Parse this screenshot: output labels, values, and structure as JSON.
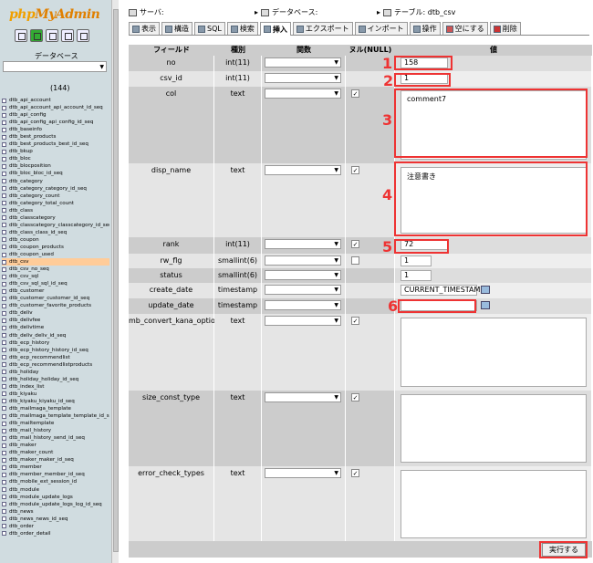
{
  "sidebar": {
    "logo_part1": "php",
    "logo_part2": "MyAdmin",
    "db_label": "データベース",
    "db_select_value": "",
    "db_count": "(144)",
    "tables": [
      "dtb_api_account",
      "dtb_api_account_api_account_id_seq",
      "dtb_api_config",
      "dtb_api_config_api_config_id_seq",
      "dtb_baseinfo",
      "dtb_best_products",
      "dtb_best_products_best_id_seq",
      "dtb_bkup",
      "dtb_bloc",
      "dtb_blocposition",
      "dtb_bloc_bloc_id_seq",
      "dtb_category",
      "dtb_category_category_id_seq",
      "dtb_category_count",
      "dtb_category_total_count",
      "dtb_class",
      "dtb_classcategory",
      "dtb_classcategory_classcategory_id_seq",
      "dtb_class_class_id_seq",
      "dtb_coupon",
      "dtb_coupon_products",
      "dtb_coupon_used",
      "dtb_csv",
      "dtb_csv_no_seq",
      "dtb_csv_sql",
      "dtb_csv_sql_sql_id_seq",
      "dtb_customer",
      "dtb_customer_customer_id_seq",
      "dtb_customer_favorite_products",
      "dtb_deliv",
      "dtb_delivfee",
      "dtb_delivtime",
      "dtb_deliv_deliv_id_seq",
      "dtb_ecp_history",
      "dtb_ecp_history_history_id_seq",
      "dtb_ecp_recommendlist",
      "dtb_ecp_recommendlistproducts",
      "dtb_holiday",
      "dtb_holiday_holiday_id_seq",
      "dtb_index_list",
      "dtb_kiyaku",
      "dtb_kiyaku_kiyaku_id_seq",
      "dtb_mailmaga_template",
      "dtb_mailmaga_template_template_id_seq",
      "dtb_mailtemplate",
      "dtb_mail_history",
      "dtb_mail_history_send_id_seq",
      "dtb_maker",
      "dtb_maker_count",
      "dtb_maker_maker_id_seq",
      "dtb_member",
      "dtb_member_member_id_seq",
      "dtb_mobile_ext_session_id",
      "dtb_module",
      "dtb_module_update_logs",
      "dtb_module_update_logs_log_id_seq",
      "dtb_news",
      "dtb_news_news_id_seq",
      "dtb_order",
      "dtb_order_detail"
    ],
    "selected_index": 22
  },
  "breadcrumb": {
    "server": "サーバ:",
    "database": "データベース:",
    "table": "テーブル: dtb_csv"
  },
  "tabs": [
    {
      "label": "表示",
      "cls": ""
    },
    {
      "label": "構造",
      "cls": ""
    },
    {
      "label": "SQL",
      "cls": ""
    },
    {
      "label": "検索",
      "cls": ""
    },
    {
      "label": "挿入",
      "cls": "active"
    },
    {
      "label": "エクスポート",
      "cls": ""
    },
    {
      "label": "インポート",
      "cls": ""
    },
    {
      "label": "操作",
      "cls": ""
    },
    {
      "label": "空にする",
      "cls": "empty"
    },
    {
      "label": "削除",
      "cls": "del"
    }
  ],
  "headers": {
    "field": "フィールド",
    "type": "種別",
    "function": "関数",
    "null": "ヌル(NULL)",
    "value": "値"
  },
  "rows": [
    {
      "field": "no",
      "type": "int(11)",
      "null_check": false,
      "value": "158",
      "input": "text",
      "annotation": "1"
    },
    {
      "field": "csv_id",
      "type": "int(11)",
      "null_check": false,
      "value": "1",
      "input": "text",
      "annotation": "2"
    },
    {
      "field": "col",
      "type": "text",
      "null_check": true,
      "value": "comment7",
      "input": "textarea",
      "annotation": "3"
    },
    {
      "field": "disp_name",
      "type": "text",
      "null_check": true,
      "value": "注意書き",
      "input": "textarea",
      "annotation": "4"
    },
    {
      "field": "rank",
      "type": "int(11)",
      "null_check": true,
      "value": "72",
      "input": "text",
      "annotation": "5"
    },
    {
      "field": "rw_flg",
      "type": "smallint(6)",
      "null_check": false,
      "value": "1",
      "input": "text",
      "annotation": ""
    },
    {
      "field": "status",
      "type": "smallint(6)",
      "null_check": false,
      "value": "1",
      "input": "text",
      "annotation": ""
    },
    {
      "field": "create_date",
      "type": "timestamp",
      "null_check": false,
      "value": "CURRENT_TIMESTAM",
      "input": "text",
      "annotation": ""
    },
    {
      "field": "update_date",
      "type": "timestamp",
      "null_check": false,
      "value": "",
      "input": "text",
      "annotation": "6"
    },
    {
      "field": "mb_convert_kana_option",
      "type": "text",
      "null_check": true,
      "value": "",
      "input": "textarea",
      "annotation": ""
    },
    {
      "field": "size_const_type",
      "type": "text",
      "null_check": true,
      "value": "",
      "input": "textarea",
      "annotation": ""
    },
    {
      "field": "error_check_types",
      "type": "text",
      "null_check": true,
      "value": "",
      "input": "textarea",
      "annotation": ""
    }
  ],
  "execute_label": "実行する"
}
